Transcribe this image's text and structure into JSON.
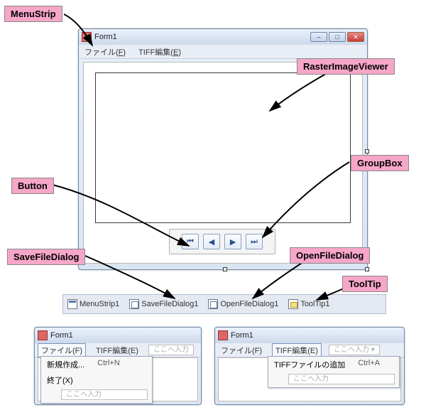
{
  "callouts": {
    "menustrip": "MenuStrip",
    "rasterImageViewer": "RasterImageViewer",
    "button": "Button",
    "groupBox": "GroupBox",
    "saveFileDialog": "SaveFileDialog",
    "openFileDialog": "OpenFileDialog",
    "toolTip": "ToolTip"
  },
  "mainWindow": {
    "title": "Form1",
    "menu": {
      "file": "ファイル(F)",
      "fileKey": "F",
      "tiff": "TIFF編集(E)",
      "tiffKey": "E"
    },
    "nav": {
      "first": "⏮",
      "prev": "◀",
      "next": "▶",
      "last": "⏭"
    }
  },
  "tray": {
    "menuStrip": "MenuStrip1",
    "saveFileDialog": "SaveFileDialog1",
    "openFileDialog": "OpenFileDialog1",
    "toolTip": "ToolTip1"
  },
  "smallLeft": {
    "title": "Form1",
    "menu": {
      "file": "ファイル(F)",
      "tiff": "TIFF編集(E)",
      "typeHere": "ここへ入力"
    },
    "dd": {
      "item1": "新規作成...",
      "item1_short": "Ctrl+N",
      "item2": "終了(X)",
      "typeHere": "ここへ入力"
    }
  },
  "smallRight": {
    "title": "Form1",
    "menu": {
      "file": "ファイル(F)",
      "tiff": "TIFF編集(E)",
      "typeHere": "ここへ入力"
    },
    "dd": {
      "item1": "TIFFファイルの追加",
      "item1_short": "Ctrl+A",
      "typeHere": "ここへ入力"
    }
  }
}
